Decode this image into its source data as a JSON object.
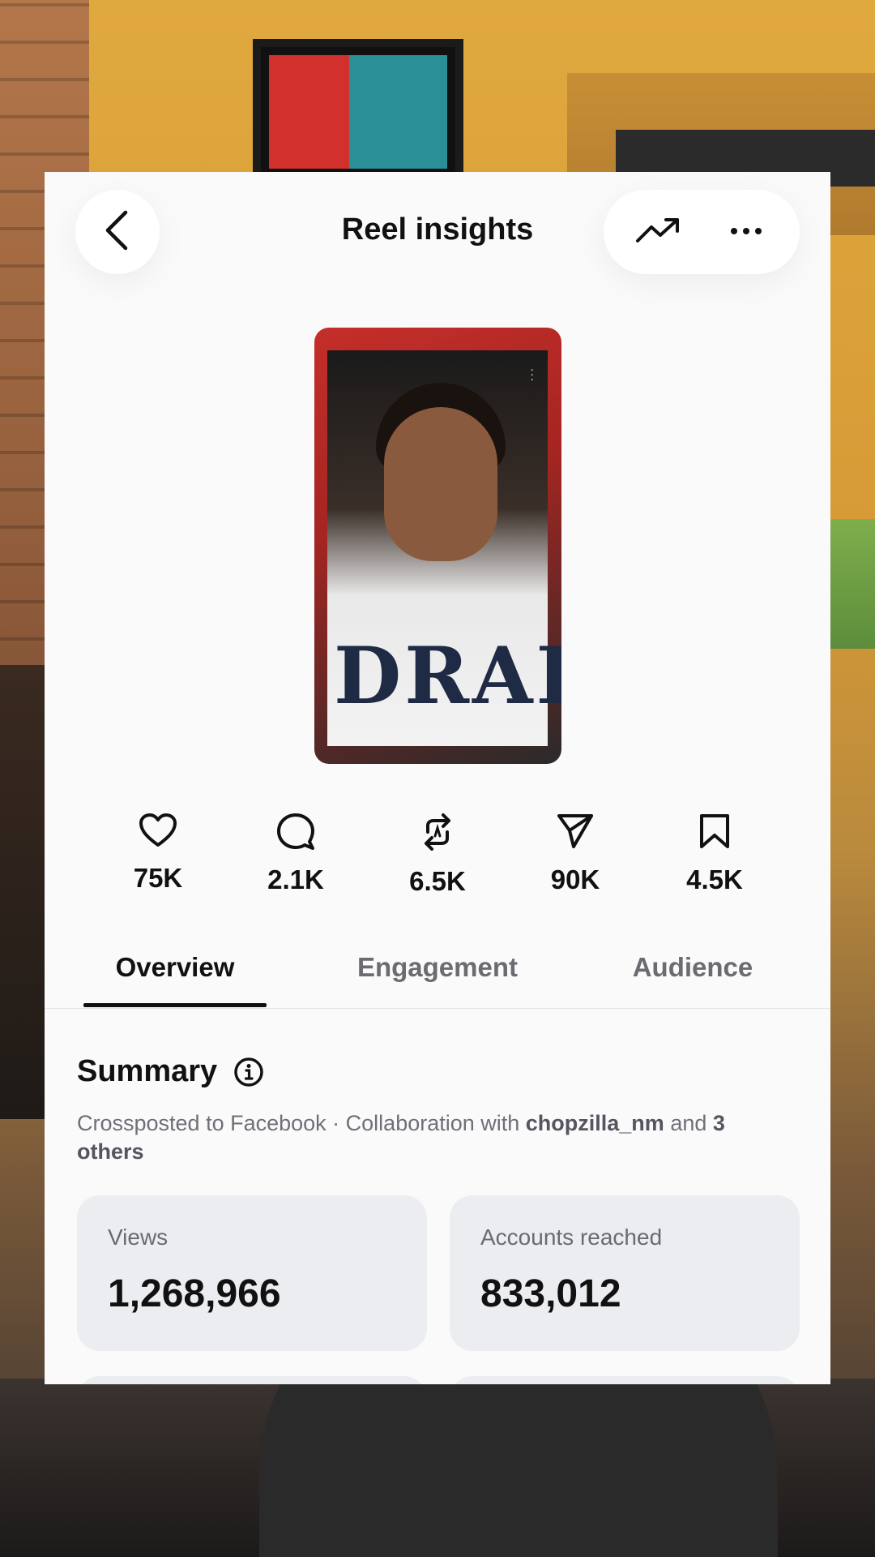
{
  "header": {
    "title": "Reel insights"
  },
  "reel": {
    "shirt_text": "DRAK"
  },
  "stats": [
    {
      "icon": "heart-icon",
      "value": "75K"
    },
    {
      "icon": "comment-icon",
      "value": "2.1K"
    },
    {
      "icon": "repost-icon",
      "value": "6.5K"
    },
    {
      "icon": "share-icon",
      "value": "90K"
    },
    {
      "icon": "bookmark-icon",
      "value": "4.5K"
    }
  ],
  "tabs": [
    {
      "label": "Overview",
      "active": true
    },
    {
      "label": "Engagement",
      "active": false
    },
    {
      "label": "Audience",
      "active": false
    }
  ],
  "summary": {
    "title": "Summary",
    "crosspost_text": "Crossposted to Facebook · Collaboration with ",
    "collaborator": "chopzilla_nm",
    "and_text": " and ",
    "others": "3 others"
  },
  "metrics": [
    {
      "label": "Views",
      "value": "1,268,966"
    },
    {
      "label": "Accounts reached",
      "value": "833,012"
    }
  ],
  "colors": {
    "card_bg": "#fafafb",
    "metric_bg": "#ecedf1",
    "text_primary": "#111111",
    "text_secondary": "#6f6f78"
  }
}
